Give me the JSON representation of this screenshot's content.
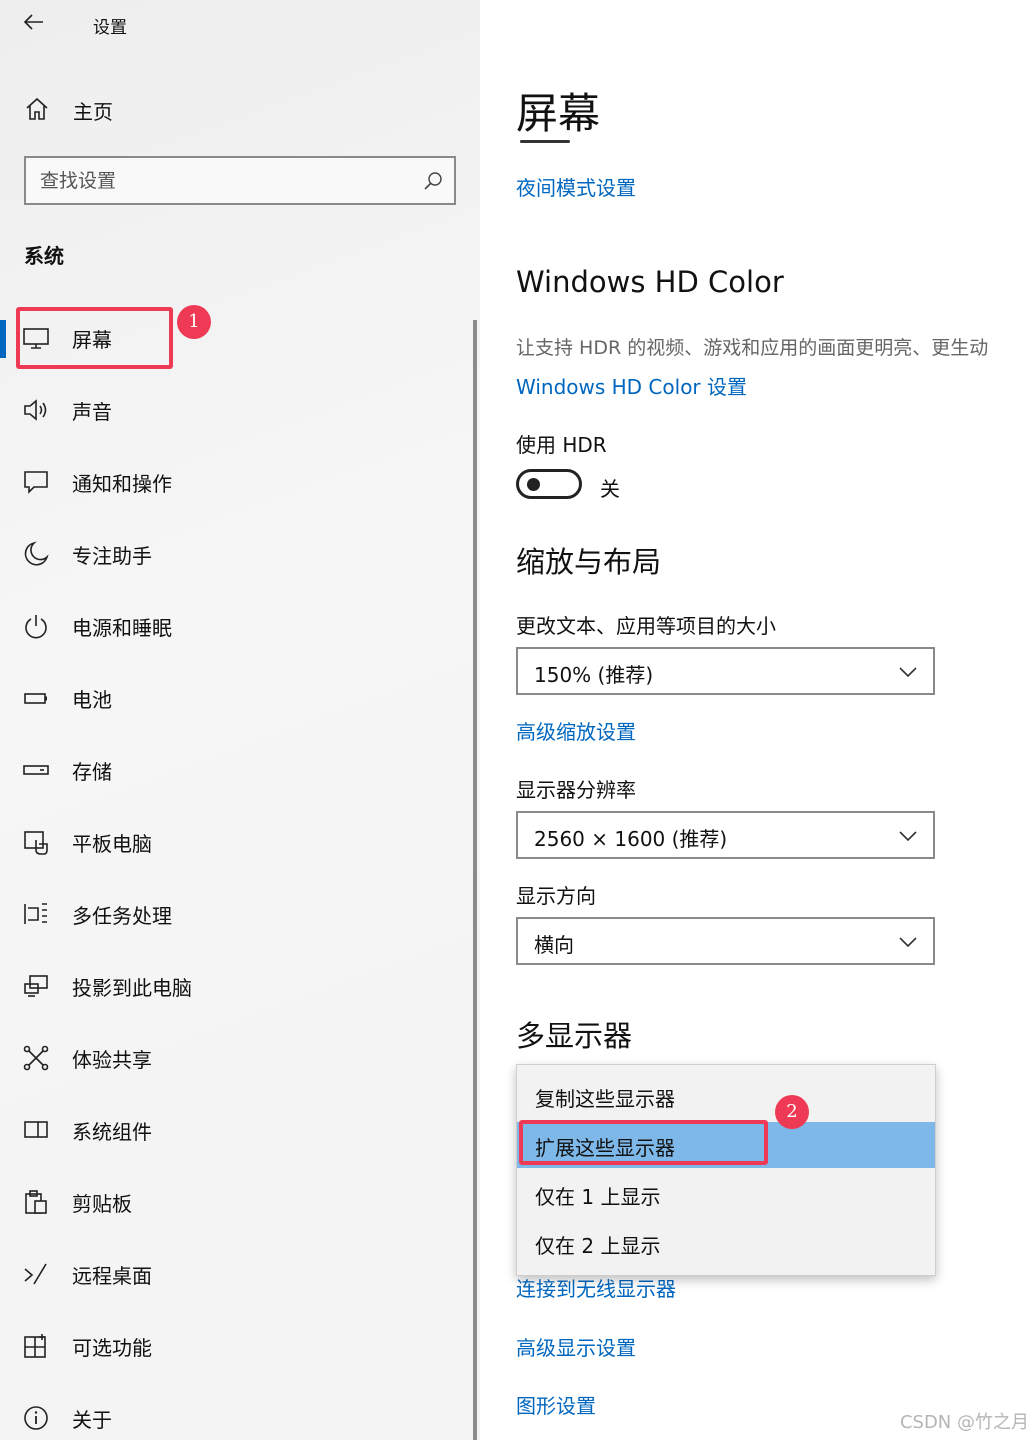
{
  "app": {
    "title": "设置"
  },
  "sidebar": {
    "home_label": "主页",
    "search_placeholder": "查找设置",
    "section_title": "系统",
    "items": [
      {
        "label": "屏幕",
        "icon": "monitor-icon",
        "selected": true
      },
      {
        "label": "声音",
        "icon": "speaker-icon"
      },
      {
        "label": "通知和操作",
        "icon": "notification-icon"
      },
      {
        "label": "专注助手",
        "icon": "moon-icon"
      },
      {
        "label": "电源和睡眠",
        "icon": "power-icon"
      },
      {
        "label": "电池",
        "icon": "battery-icon"
      },
      {
        "label": "存储",
        "icon": "storage-icon"
      },
      {
        "label": "平板电脑",
        "icon": "tablet-icon"
      },
      {
        "label": "多任务处理",
        "icon": "multitask-icon"
      },
      {
        "label": "投影到此电脑",
        "icon": "project-icon"
      },
      {
        "label": "体验共享",
        "icon": "share-icon"
      },
      {
        "label": "系统组件",
        "icon": "components-icon"
      },
      {
        "label": "剪贴板",
        "icon": "clipboard-icon"
      },
      {
        "label": "远程桌面",
        "icon": "remote-icon"
      },
      {
        "label": "可选功能",
        "icon": "optional-features-icon"
      },
      {
        "label": "关于",
        "icon": "info-icon"
      }
    ]
  },
  "main": {
    "title": "屏幕",
    "night_mode_link": "夜间模式设置",
    "hdr": {
      "heading": "Windows HD Color",
      "description": "让支持 HDR 的视频、游戏和应用的画面更明亮、更生动",
      "link": "Windows HD Color 设置",
      "toggle_label": "使用 HDR",
      "toggle_state": "关",
      "toggle_on": false
    },
    "scale": {
      "heading": "缩放与布局",
      "size_label": "更改文本、应用等项目的大小",
      "size_value": "150% (推荐)",
      "advanced_link": "高级缩放设置",
      "resolution_label": "显示器分辨率",
      "resolution_value": "2560 × 1600 (推荐)",
      "orientation_label": "显示方向",
      "orientation_value": "横向"
    },
    "multi": {
      "heading": "多显示器",
      "options": [
        "复制这些显示器",
        "扩展这些显示器",
        "仅在 1 上显示",
        "仅在 2 上显示"
      ],
      "selected_index": 1,
      "wireless_link": "连接到无线显示器",
      "advanced_display_link": "高级显示设置",
      "graphics_link": "图形设置"
    }
  },
  "annotations": {
    "badge_1": "1",
    "badge_2": "2",
    "color": "#ee3a55"
  },
  "accent_color": "#0067c0",
  "watermark": "CSDN @竹之月"
}
